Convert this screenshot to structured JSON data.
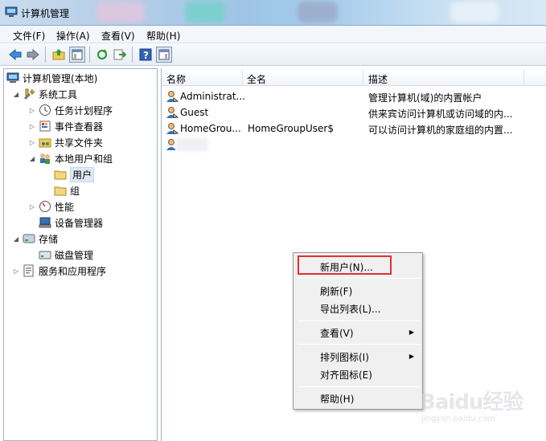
{
  "window": {
    "title": "计算机管理"
  },
  "menubar": {
    "file": "文件(F)",
    "action": "操作(A)",
    "view": "查看(V)",
    "help": "帮助(H)"
  },
  "tree": {
    "root": "计算机管理(本地)",
    "system_tools": "系统工具",
    "task_scheduler": "任务计划程序",
    "event_viewer": "事件查看器",
    "shared_folders": "共享文件夹",
    "local_users_groups": "本地用户和组",
    "users": "用户",
    "groups": "组",
    "performance": "性能",
    "device_manager": "设备管理器",
    "storage": "存储",
    "disk_management": "磁盘管理",
    "services_apps": "服务和应用程序"
  },
  "list": {
    "columns": {
      "name": "名称",
      "fullname": "全名",
      "description": "描述"
    },
    "rows": [
      {
        "name": "Administrat...",
        "fullname": "",
        "description": "管理计算机(域)的内置帐户"
      },
      {
        "name": "Guest",
        "fullname": "",
        "description": "供来宾访问计算机或访问域的内..."
      },
      {
        "name": "HomeGrou...",
        "fullname": "HomeGroupUser$",
        "description": "可以访问计算机的家庭组的内置..."
      }
    ]
  },
  "context_menu": {
    "new_user": "新用户(N)...",
    "refresh": "刷新(F)",
    "export": "导出列表(L)...",
    "view": "查看(V)",
    "arrange": "排列图标(I)",
    "align": "对齐图标(E)",
    "help": "帮助(H)"
  },
  "watermark": {
    "brand": "Baidu经验",
    "site": "jingyan.baidu.com"
  },
  "colors": {
    "highlight_border": "#e03030",
    "selection": "#dfe9f5"
  }
}
